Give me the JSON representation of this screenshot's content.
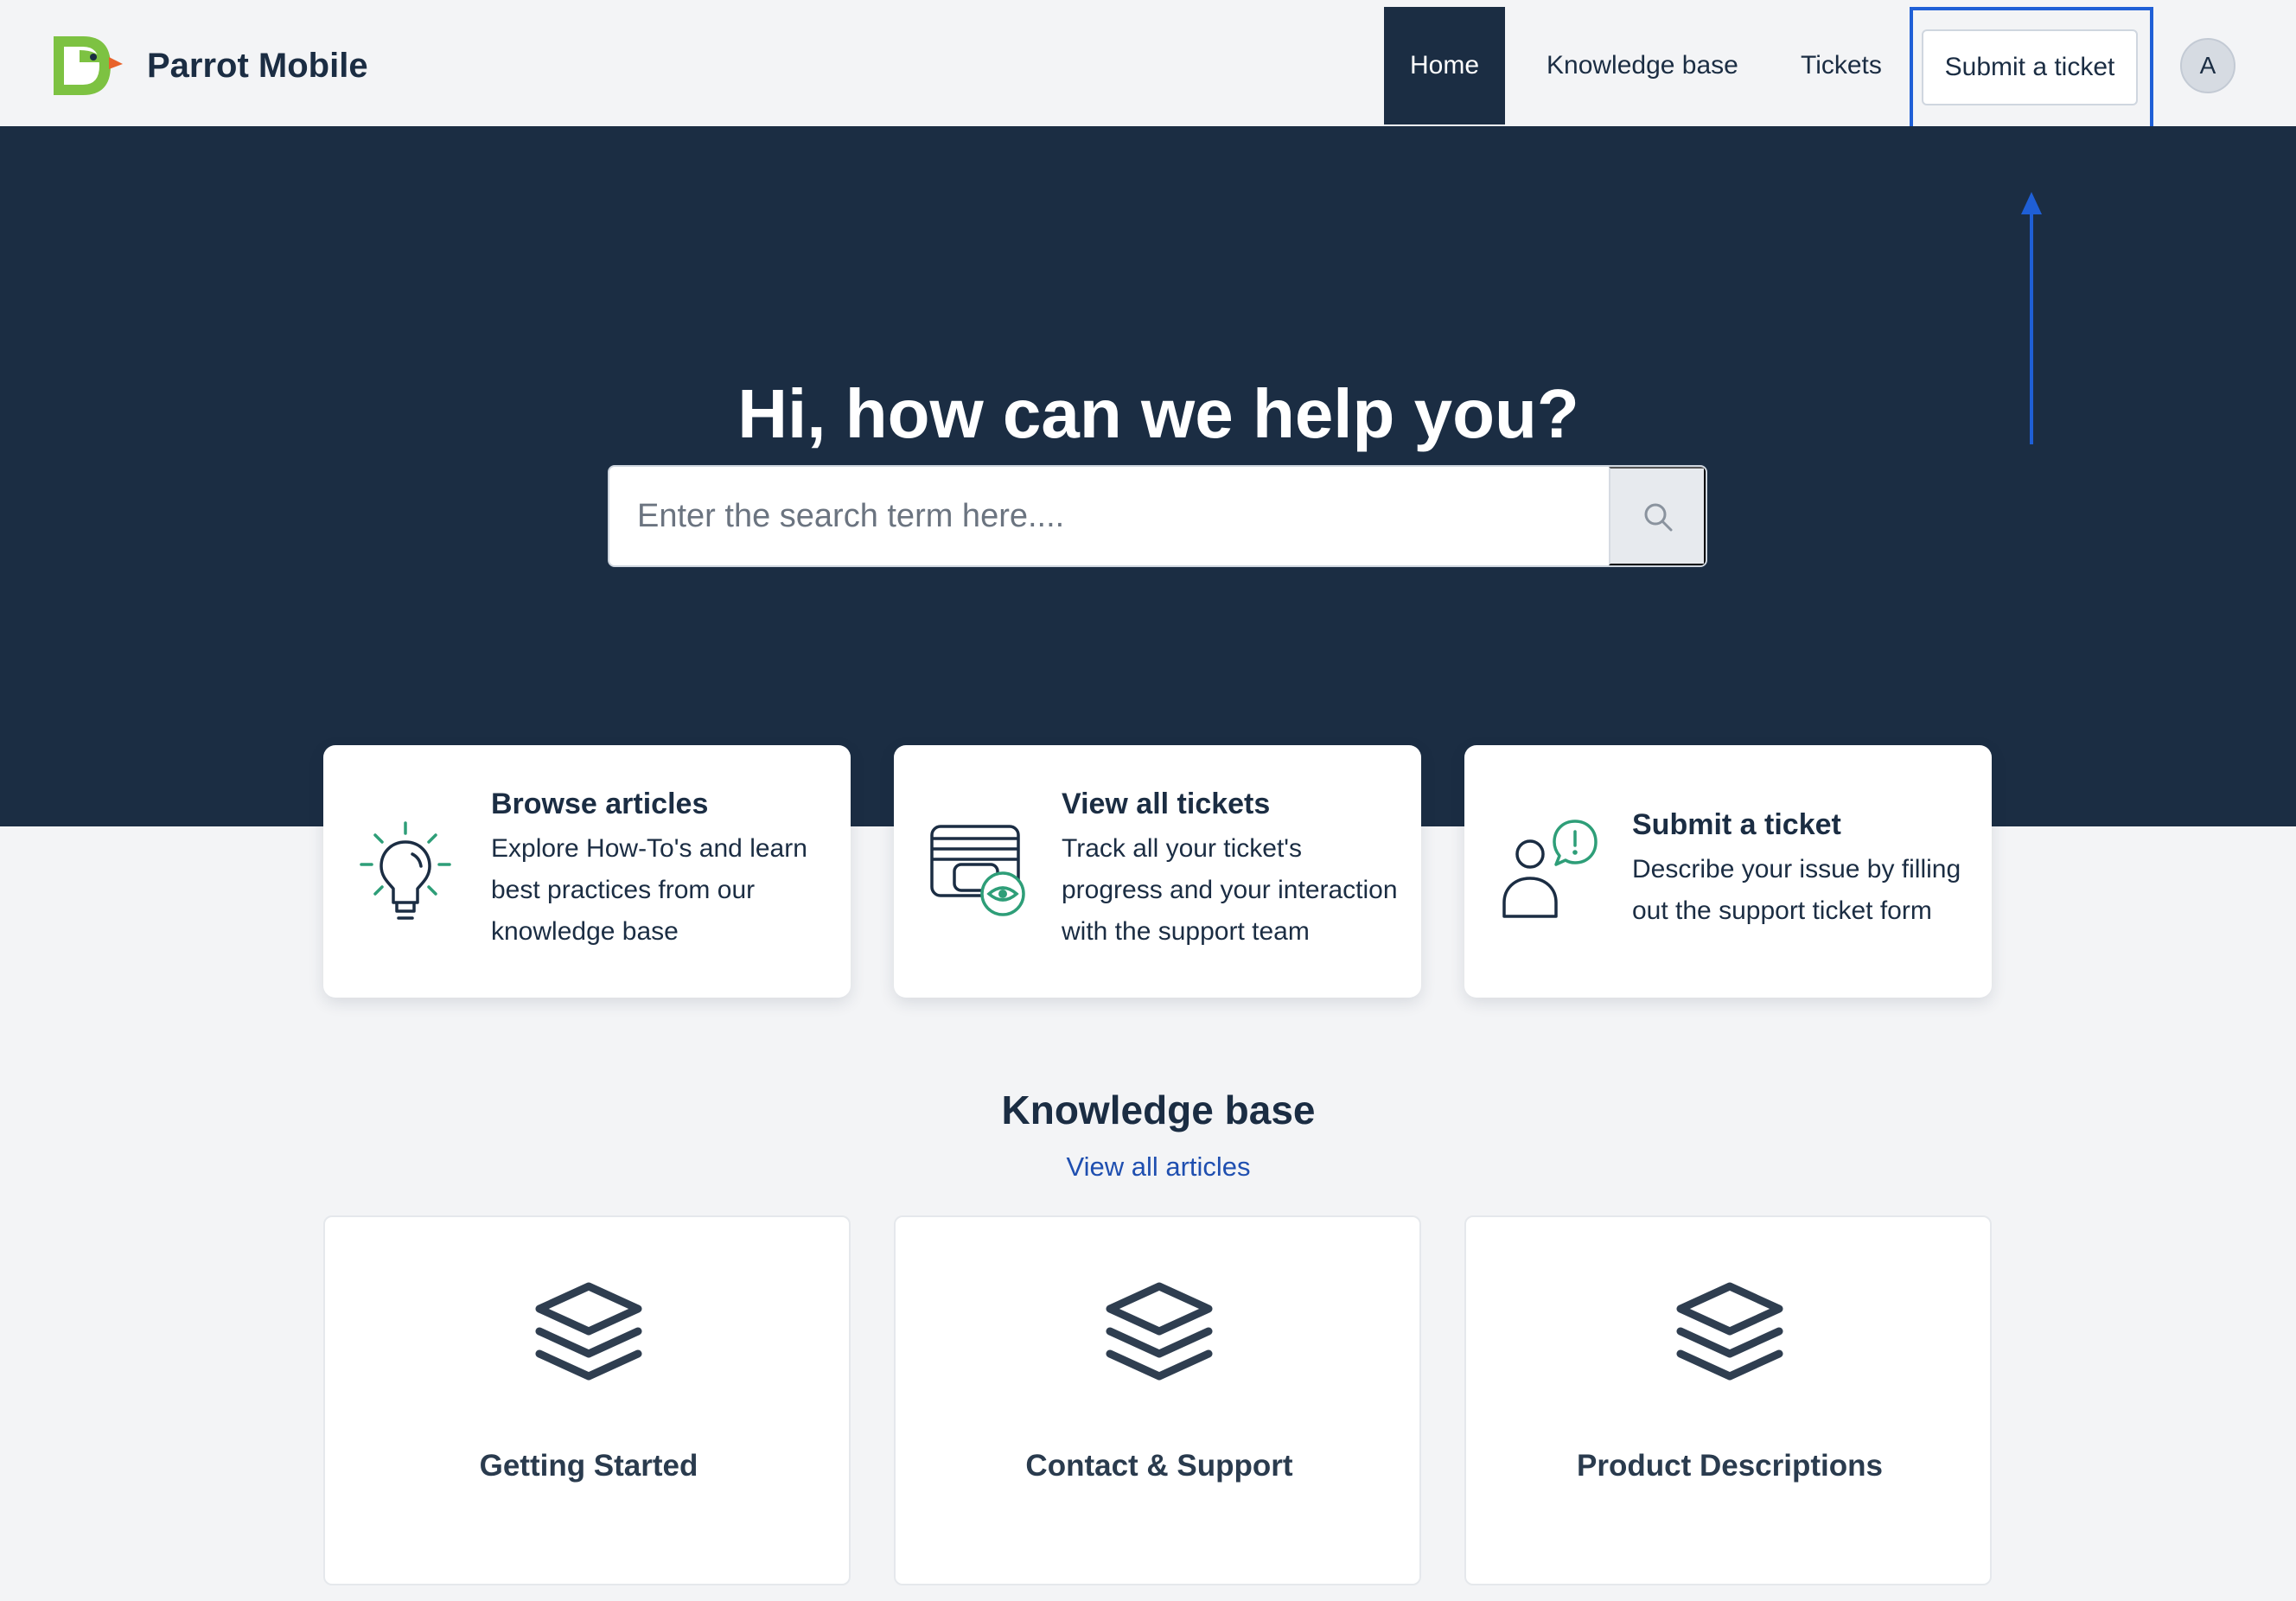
{
  "brand": {
    "name": "Parrot Mobile",
    "logo_icon": "parrot-logo-icon",
    "colors": {
      "green": "#7dc242",
      "orange": "#e8632b"
    }
  },
  "nav": {
    "home": "Home",
    "knowledge_base": "Knowledge base",
    "tickets": "Tickets",
    "submit_ticket": "Submit a ticket",
    "avatar_initial": "A"
  },
  "hero": {
    "title": "Hi, how can we help you?",
    "search_placeholder": "Enter the search term here....",
    "search_value": ""
  },
  "cards": [
    {
      "icon": "lightbulb-icon",
      "title": "Browse articles",
      "description": "Explore How-To's and learn best practices from our knowledge base"
    },
    {
      "icon": "tickets-eye-icon",
      "title": "View all tickets",
      "description": "Track all your ticket's progress and your interaction with the support team"
    },
    {
      "icon": "person-alert-icon",
      "title": "Submit a ticket",
      "description": "Describe your issue by filling out the support ticket form"
    }
  ],
  "knowledge_base": {
    "heading": "Knowledge base",
    "view_all": "View all articles",
    "categories": [
      {
        "icon": "layers-icon",
        "label": "Getting Started"
      },
      {
        "icon": "layers-icon",
        "label": "Contact & Support"
      },
      {
        "icon": "layers-icon",
        "label": "Product Descriptions"
      }
    ]
  },
  "colors": {
    "navy": "#1b2d43",
    "accent_green": "#2e9e78",
    "link_blue": "#1f4fb0",
    "annotation_blue": "#1f5fd6",
    "page_bg": "#f3f4f6"
  }
}
